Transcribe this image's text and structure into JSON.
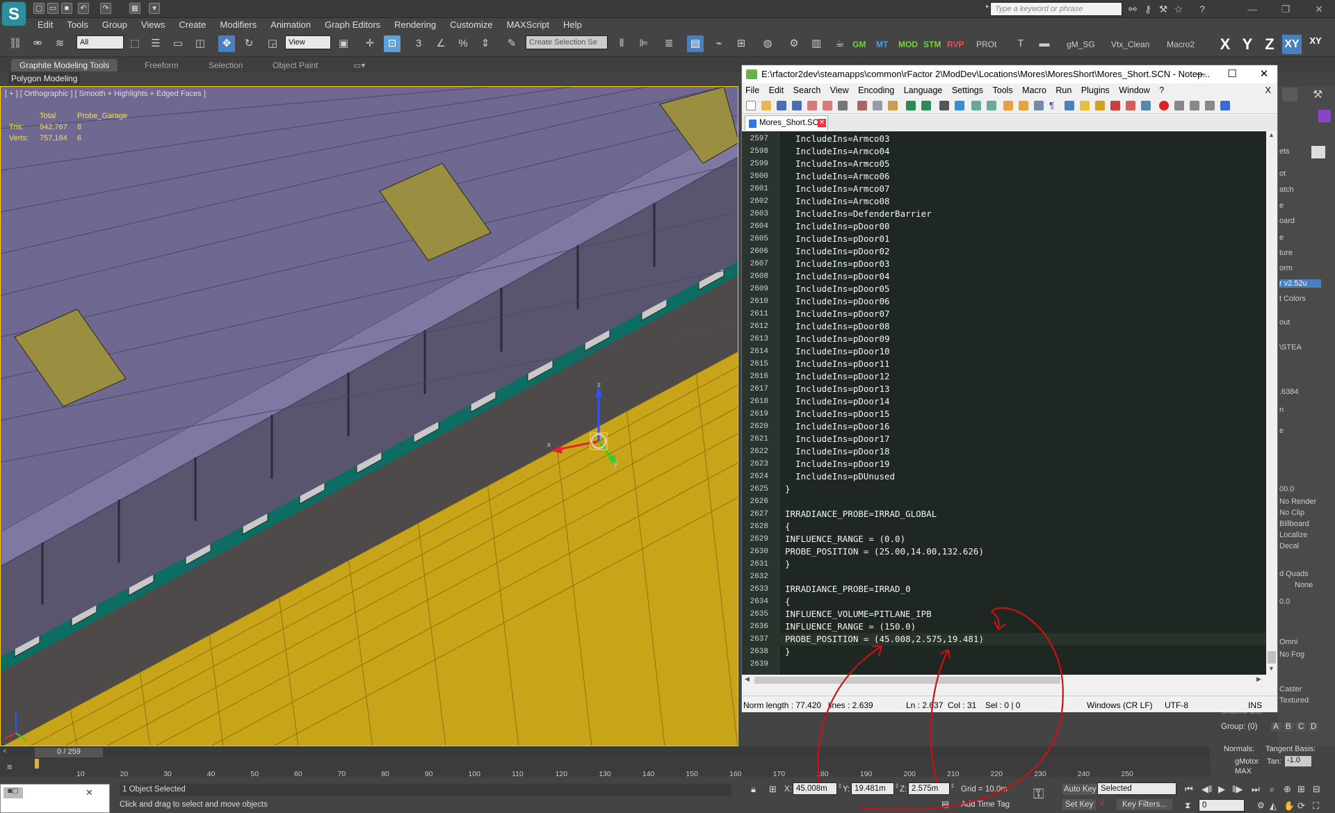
{
  "app": {
    "logo": "S"
  },
  "search": {
    "placeholder": "Type a keyword or phrase"
  },
  "menu": [
    "Edit",
    "Tools",
    "Group",
    "Views",
    "Create",
    "Modifiers",
    "Animation",
    "Graph Editors",
    "Rendering",
    "Customize",
    "MAXScript",
    "Help"
  ],
  "toolbar": {
    "filter": "All",
    "ref_coord": "View",
    "selection_set": "Create Selection Se",
    "labels": {
      "prot": "PROt",
      "gm": "GM",
      "mt": "MT",
      "mod": "MOD",
      "stm": "STM",
      "rvp": "RVP",
      "gm_sg": "gM_SG",
      "vtx": "Vtx_Clean",
      "macro2": "Macro2"
    },
    "axes": [
      "X",
      "Y",
      "Z",
      "XY",
      "XY"
    ]
  },
  "ribbon": {
    "tabs": [
      "Graphite Modeling Tools",
      "Freeform",
      "Selection",
      "Object Paint"
    ],
    "panel": "Polygon Modeling"
  },
  "viewport": {
    "label": "[ + ] [ Orthographic ] [ Smooth + Highlights + Edged Faces ]",
    "stats": {
      "col_total": "Total",
      "col_obj": "Probe_Garage",
      "tris_label": "Tris:",
      "tris_total": "942,767",
      "tris_obj": "8",
      "verts_label": "Verts:",
      "verts_total": "757,184",
      "verts_obj": "6"
    },
    "gizmo": {
      "x": "x",
      "y": "y",
      "z": "z"
    }
  },
  "npp": {
    "title": "E:\\rfactor2dev\\steamapps\\common\\rFactor 2\\ModDev\\Locations\\Mores\\MoresShort\\Mores_Short.SCN - Notep...",
    "menu": [
      "File",
      "Edit",
      "Search",
      "View",
      "Encoding",
      "Language",
      "Settings",
      "Tools",
      "Macro",
      "Run",
      "Plugins",
      "Window",
      "?"
    ],
    "close_x": "X",
    "tab": "Mores_Short.SCN",
    "lines": [
      {
        "n": "2597",
        "t": "  IncludeIns=Armco03"
      },
      {
        "n": "2598",
        "t": "  IncludeIns=Armco04"
      },
      {
        "n": "2599",
        "t": "  IncludeIns=Armco05"
      },
      {
        "n": "2600",
        "t": "  IncludeIns=Armco06"
      },
      {
        "n": "2601",
        "t": "  IncludeIns=Armco07"
      },
      {
        "n": "2602",
        "t": "  IncludeIns=Armco08"
      },
      {
        "n": "2603",
        "t": "  IncludeIns=DefenderBarrier"
      },
      {
        "n": "2604",
        "t": "  IncludeIns=pDoor00"
      },
      {
        "n": "2605",
        "t": "  IncludeIns=pDoor01"
      },
      {
        "n": "2606",
        "t": "  IncludeIns=pDoor02"
      },
      {
        "n": "2607",
        "t": "  IncludeIns=pDoor03"
      },
      {
        "n": "2608",
        "t": "  IncludeIns=pDoor04"
      },
      {
        "n": "2609",
        "t": "  IncludeIns=pDoor05"
      },
      {
        "n": "2610",
        "t": "  IncludeIns=pDoor06"
      },
      {
        "n": "2611",
        "t": "  IncludeIns=pDoor07"
      },
      {
        "n": "2612",
        "t": "  IncludeIns=pDoor08"
      },
      {
        "n": "2613",
        "t": "  IncludeIns=pDoor09"
      },
      {
        "n": "2614",
        "t": "  IncludeIns=pDoor10"
      },
      {
        "n": "2615",
        "t": "  IncludeIns=pDoor11"
      },
      {
        "n": "2616",
        "t": "  IncludeIns=pDoor12"
      },
      {
        "n": "2617",
        "t": "  IncludeIns=pDoor13"
      },
      {
        "n": "2618",
        "t": "  IncludeIns=pDoor14"
      },
      {
        "n": "2619",
        "t": "  IncludeIns=pDoor15"
      },
      {
        "n": "2620",
        "t": "  IncludeIns=pDoor16"
      },
      {
        "n": "2621",
        "t": "  IncludeIns=pDoor17"
      },
      {
        "n": "2622",
        "t": "  IncludeIns=pDoor18"
      },
      {
        "n": "2623",
        "t": "  IncludeIns=pDoor19"
      },
      {
        "n": "2624",
        "t": "  IncludeIns=pDUnused"
      },
      {
        "n": "2625",
        "t": "}"
      },
      {
        "n": "2626",
        "t": ""
      },
      {
        "n": "2627",
        "t": "IRRADIANCE_PROBE=IRRAD_GLOBAL"
      },
      {
        "n": "2628",
        "t": "{"
      },
      {
        "n": "2629",
        "t": "INFLUENCE_RANGE = (0.0)"
      },
      {
        "n": "2630",
        "t": "PROBE_POSITION = (25.00,14.00,132.626)"
      },
      {
        "n": "2631",
        "t": "}"
      },
      {
        "n": "2632",
        "t": ""
      },
      {
        "n": "2633",
        "t": "IRRADIANCE_PROBE=IRRAD_0"
      },
      {
        "n": "2634",
        "t": "{"
      },
      {
        "n": "2635",
        "t": "INFLUENCE_VOLUME=PITLANE_IPB"
      },
      {
        "n": "2636",
        "t": "INFLUENCE_RANGE = (150.0)"
      },
      {
        "n": "2637",
        "t": "PROBE_POSITION = (45.008,2.575,19.481)"
      },
      {
        "n": "2638",
        "t": "}"
      },
      {
        "n": "2639",
        "t": ""
      }
    ],
    "status": {
      "length": "Norm length : 77.420",
      "lines": "lines : 2.639",
      "ln": "Ln : 2.637",
      "col": "Col : 31",
      "sel": "Sel : 0 | 0",
      "eol": "Windows (CR LF)",
      "enc": "UTF-8",
      "ins": "INS"
    }
  },
  "cmdpanel": [
    "ets",
    "ot",
    "atch",
    "e",
    "oard",
    "e",
    "ture",
    "orm",
    "r v2.52u",
    "t Colors",
    "out",
    "\\STEA",
    ".6384",
    "n",
    "e",
    "00.0",
    "No Render",
    "No Clip",
    "Billboard",
    "Localize",
    "Decal",
    "d Quads",
    "None",
    "0.0",
    "Omni",
    "No Fog",
    "Caster",
    "Textured",
    "Shadow Out:",
    "Group: (0)",
    "Normals:",
    "Tangent Basis:",
    "gMotor",
    "Tan:",
    "-1.0",
    "MAX"
  ],
  "cmdpanel_abcd": [
    "A",
    "B",
    "C",
    "D"
  ],
  "timeline": {
    "slider": "0 / 259",
    "ticks": [
      "10",
      "20",
      "30",
      "40",
      "50",
      "60",
      "70",
      "80",
      "90",
      "100",
      "110",
      "120",
      "130",
      "140",
      "150",
      "160",
      "170",
      "180",
      "190",
      "200",
      "210",
      "220",
      "230",
      "240",
      "250"
    ]
  },
  "status": {
    "selected": "1 Object Selected",
    "hint": "Click and drag to select and move objects",
    "x_label": "X:",
    "x": "45.008m",
    "y_label": "Y:",
    "y": "19.481m",
    "z_label": "Z:",
    "z": "2.575m",
    "grid": "Grid = 10.0m",
    "add_time_tag": "Add Time Tag",
    "auto_key": "Auto Key",
    "set_key": "Set Key",
    "key_mode": "Selected",
    "key_filters": "Key Filters...",
    "frame": "0"
  },
  "colors": {
    "accent": "#4a7fc0",
    "viewport_bg": "#4a4a4a",
    "npp_bg": "#1e2722",
    "annotation": "#cc1111",
    "roof": "#6f6890",
    "ground": "#c8a418",
    "teal": "#0c6e62"
  }
}
